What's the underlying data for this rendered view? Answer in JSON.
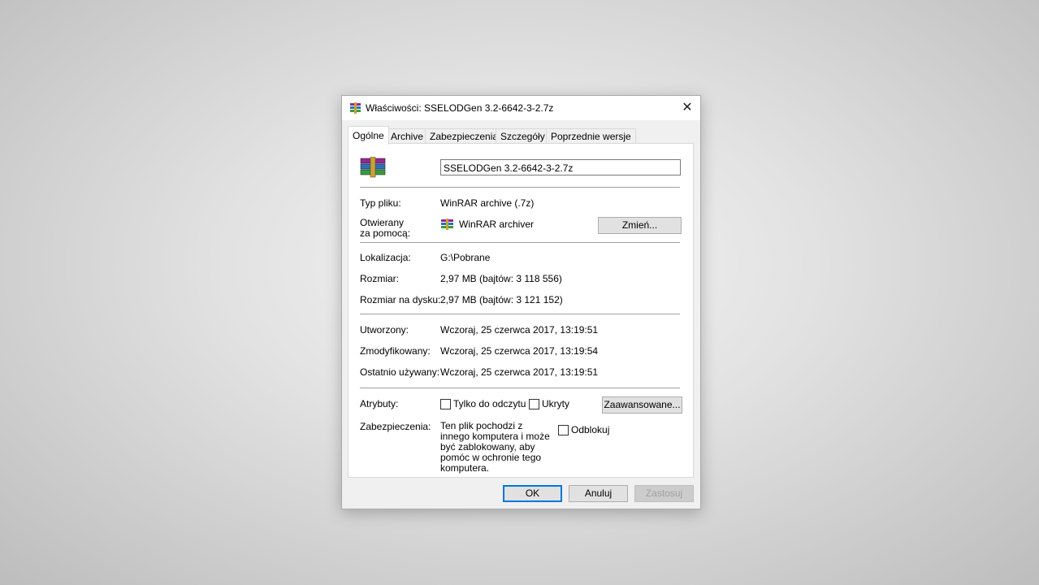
{
  "window": {
    "title": "Właściwości: SSELODGen 3.2-6642-3-2.7z",
    "close_label": "✕",
    "icon": "winrar-archive-icon"
  },
  "tabs": [
    {
      "label": "Ogólne",
      "active": true
    },
    {
      "label": "Archive",
      "active": false
    },
    {
      "label": "Zabezpieczenia",
      "active": false
    },
    {
      "label": "Szczegóły",
      "active": false
    },
    {
      "label": "Poprzednie wersje",
      "active": false
    }
  ],
  "general": {
    "file_name": "SSELODGen 3.2-6642-3-2.7z",
    "file_type_label": "Typ pliku:",
    "file_type_value": "WinRAR archive (.7z)",
    "opens_with_label_1": "Otwierany",
    "opens_with_label_2": "za pomocą:",
    "opens_with_value": "WinRAR archiver",
    "change_button": "Zmień...",
    "location_label": "Lokalizacja:",
    "location_value": "G:\\Pobrane",
    "size_label": "Rozmiar:",
    "size_value": "2,97 MB (bajtów: 3 118 556)",
    "size_on_disk_label": "Rozmiar na dysku:",
    "size_on_disk_value": "2,97 MB (bajtów: 3 121 152)",
    "created_label": "Utworzony:",
    "created_value": "Wczoraj, 25 czerwca 2017, 13:19:51",
    "modified_label": "Zmodyfikowany:",
    "modified_value": "Wczoraj, 25 czerwca 2017, 13:19:54",
    "accessed_label": "Ostatnio używany:",
    "accessed_value": "Wczoraj, 25 czerwca 2017, 13:19:51",
    "attributes_label": "Atrybuty:",
    "readonly_label": "Tylko do odczytu",
    "readonly_checked": false,
    "hidden_label": "Ukryty",
    "hidden_checked": false,
    "advanced_button": "Zaawansowane...",
    "security_label": "Zabezpieczenia:",
    "security_text": "Ten plik pochodzi z innego komputera i może być zablokowany, aby pomóc w ochronie tego komputera.",
    "unblock_label": "Odblokuj",
    "unblock_checked": false
  },
  "footer": {
    "ok_button": "OK",
    "cancel_button": "Anuluj",
    "apply_button": "Zastosuj",
    "apply_disabled": true
  },
  "colors": {
    "accent": "#0078d7",
    "dialog_bg": "#f0f0f0",
    "panel_bg": "#ffffff"
  }
}
